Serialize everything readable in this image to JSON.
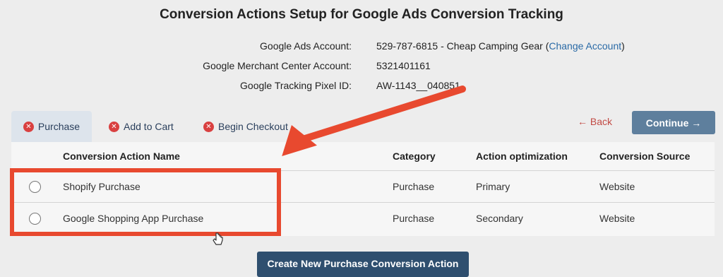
{
  "page": {
    "title": "Conversion Actions Setup for Google Ads Conversion Tracking"
  },
  "account_info": {
    "google_ads_account_label": "Google Ads Account:",
    "google_ads_account_value": "529-787-6815 - Cheap Camping Gear (",
    "change_account_link": "Change Account",
    "google_ads_account_suffix": ")",
    "merchant_center_label": "Google Merchant Center Account:",
    "merchant_center_value": "5321401161",
    "tracking_pixel_label": "Google Tracking Pixel ID:",
    "tracking_pixel_value": "AW-1143__040851"
  },
  "tabs": [
    {
      "label": "Purchase",
      "icon": "x-circle-icon",
      "active": true
    },
    {
      "label": "Add to Cart",
      "icon": "x-circle-icon",
      "active": false
    },
    {
      "label": "Begin Checkout",
      "icon": "x-circle-icon",
      "active": false
    }
  ],
  "buttons": {
    "back_label": "← Back",
    "continue_label": "Continue →",
    "create_label": "Create New Purchase Conversion Action"
  },
  "table": {
    "columns": [
      "Conversion Action Name",
      "Category",
      "Action optimization",
      "Conversion Source"
    ],
    "rows": [
      {
        "name": "Shopify Purchase",
        "category": "Purchase",
        "optimization": "Primary",
        "source": "Website"
      },
      {
        "name": "Google Shopping App Purchase",
        "category": "Purchase",
        "optimization": "Secondary",
        "source": "Website"
      }
    ]
  },
  "colors": {
    "accent_red": "#e8492f",
    "continue_button": "#5e7f9d",
    "create_button": "#2f4f6f",
    "tab_error_icon": "#d94040"
  }
}
